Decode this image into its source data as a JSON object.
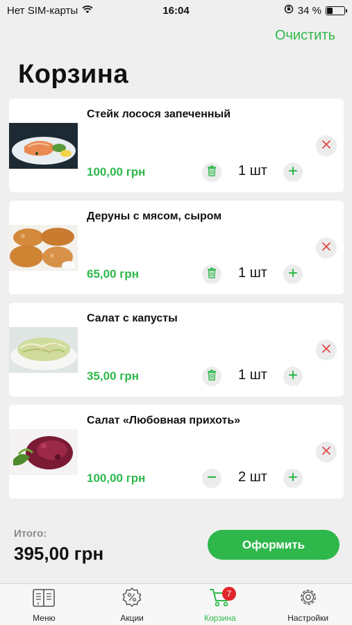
{
  "status_bar": {
    "carrier": "Нет SIM-карты",
    "time": "16:04",
    "battery_text": "34 %",
    "battery_level": 0.34,
    "icons": [
      "wifi-icon",
      "orientation-lock-icon",
      "battery-icon"
    ]
  },
  "header": {
    "clear_label": "Очистить",
    "title": "Корзина"
  },
  "items": [
    {
      "name": "Стейк лосося запеченный",
      "price": "100,00 грн",
      "qty": "1 шт",
      "decrement_icon": "trash-icon"
    },
    {
      "name": "Деруны с мясом, сыром",
      "price": "65,00 грн",
      "qty": "1 шт",
      "decrement_icon": "trash-icon"
    },
    {
      "name": "Салат с капусты",
      "price": "35,00 грн",
      "qty": "1 шт",
      "decrement_icon": "trash-icon"
    },
    {
      "name": "Салат «Любовная прихоть»",
      "price": "100,00 грн",
      "qty": "2 шт",
      "decrement_icon": "minus-icon"
    }
  ],
  "summary": {
    "total_label": "Итого:",
    "total_value": "395,00 грн",
    "checkout_label": "Оформить"
  },
  "tabs": [
    {
      "label": "Меню",
      "icon": "menu-book-icon",
      "active": false
    },
    {
      "label": "Акции",
      "icon": "discount-icon",
      "active": false
    },
    {
      "label": "Корзина",
      "icon": "cart-icon",
      "active": true,
      "badge": "7"
    },
    {
      "label": "Настройки",
      "icon": "gear-icon",
      "active": false
    }
  ],
  "colors": {
    "accent": "#2eb84b",
    "background": "#efefef",
    "badge": "#e0252b",
    "remove_x": "#e0484a"
  }
}
